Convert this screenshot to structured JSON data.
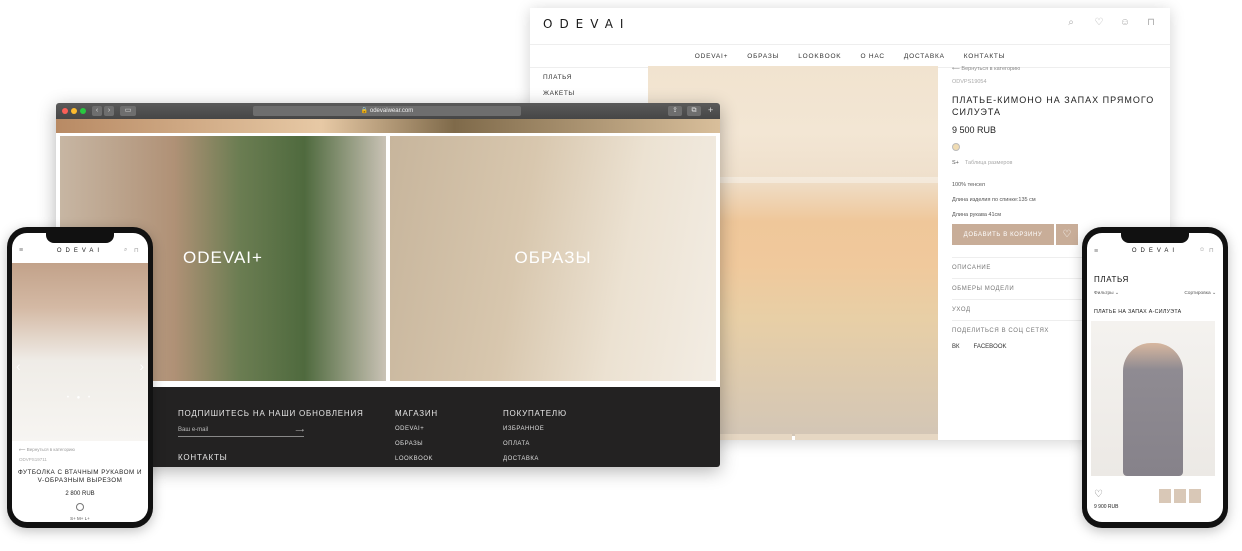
{
  "product_page": {
    "logo": "ODEVAI",
    "nav": [
      "ODEVAI+",
      "ОБРАЗЫ",
      "LOOKBOOK",
      "О НАС",
      "ДОСТАВКА",
      "КОНТАКТЫ"
    ],
    "categories": [
      "ПЛАТЬЯ",
      "ЖАКЕТЫ"
    ],
    "back_link": "⟵ Вернуться в категорию",
    "sku": "ODVPS19054",
    "title": "ПЛАТЬЕ-КИМОНО НА ЗАПАХ ПРЯМОГО СИЛУЭТА",
    "price": "9 500 RUB",
    "swatch_color": "#f0dcb3",
    "size": "S+",
    "size_table_link": "Таблица размеров",
    "details": [
      "100% тенсел",
      "Длина изделия по спинке:135 см",
      "Длина рукава 41см"
    ],
    "add_to_cart": "ДОБАВИТЬ В КОРЗИНУ",
    "accordion": [
      "ОПИСАНИЕ",
      "ОБМЕРЫ МОДЕЛИ",
      "УХОД"
    ],
    "share_label": "ПОДЕЛИТЬСЯ В СОЦ СЕТЯХ",
    "share_links": [
      "ВК",
      "FACEBOOK"
    ],
    "accent_color": "#c8ad98"
  },
  "browser": {
    "url": "🔒 odevaiwear.com",
    "cards": [
      "ODEVAI+",
      "ОБРАЗЫ"
    ],
    "footer": {
      "subscribe_title": "ПОДПИШИТЕСЬ НА НАШИ ОБНОВЛЕНИЯ",
      "email_placeholder": "Ваш e-mail",
      "contacts_title": "КОНТАКТЫ",
      "shop_title": "МАГАЗИН",
      "shop_items": [
        "ODEVAI+",
        "ОБРАЗЫ",
        "LOOKBOOK"
      ],
      "buyer_title": "ПОКУПАТЕЛЮ",
      "buyer_items": [
        "ИЗБРАННОЕ",
        "ОПЛАТА",
        "ДОСТАВКА"
      ]
    }
  },
  "phone_left": {
    "logo": "ODEVAI",
    "back_link": "⟵ Вернуться в категорию",
    "sku": "ODVPS19711",
    "title": "ФУТБОЛКА С ВТАЧНЫМ РУКАВОМ И V-ОБРАЗНЫМ ВЫРЕЗОМ",
    "price": "2 800 RUB",
    "sizes": "S+   M+   L+"
  },
  "phone_right": {
    "logo": "ODEVAI",
    "heading": "ПЛАТЬЯ",
    "filters": "Фильтры ⌄",
    "sort": "Сортировка ⌄",
    "category": "ПЛАТЬЕ НА ЗАПАХ А-СИЛУЭТА",
    "price": "9 900 RUB"
  }
}
